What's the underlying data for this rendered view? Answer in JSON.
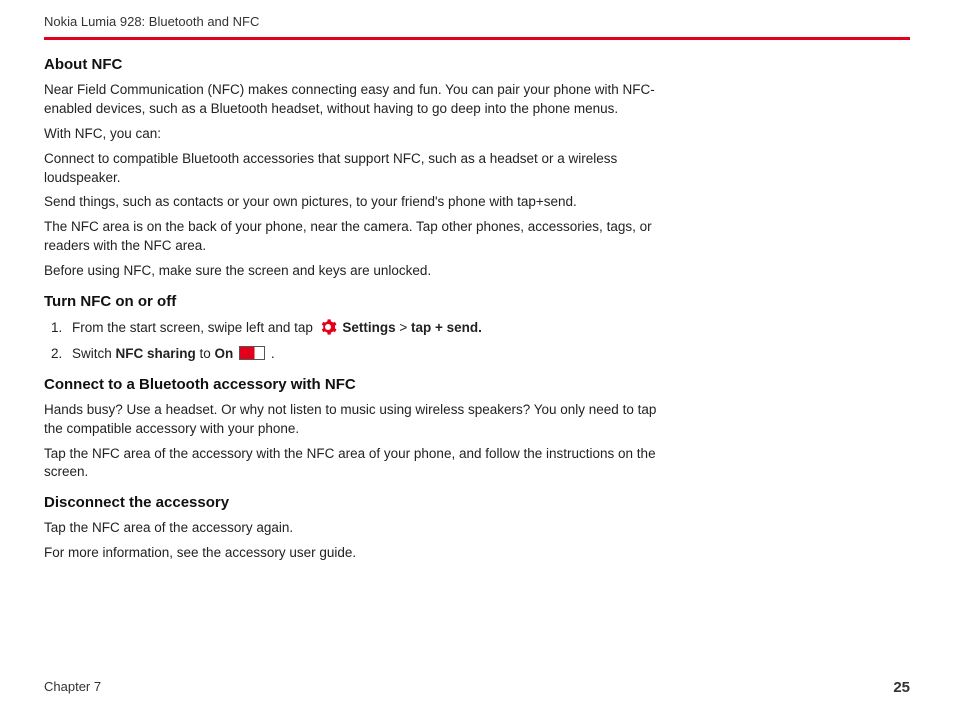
{
  "header": {
    "running_head": "Nokia Lumia 928: Bluetooth and NFC"
  },
  "sections": {
    "about_nfc": {
      "title": "About NFC",
      "p1": "Near Field Communication (NFC) makes connecting easy and fun. You can pair your phone with NFC-enabled devices, such as a Bluetooth headset, without having to go deep into the phone menus.",
      "p2": "With NFC, you can:",
      "p3": "Connect to compatible Bluetooth accessories that support NFC, such as a headset or a wireless loudspeaker.",
      "p4": "Send things, such as contacts or your own pictures, to your friend's phone with tap+send.",
      "p5": "The NFC area is on the back of your phone, near the camera. Tap other phones, accessories, tags, or readers with the NFC area.",
      "p6": "Before using NFC, make sure the screen and keys are unlocked."
    },
    "turn_nfc": {
      "title": "Turn NFC on or off",
      "step1_a": "From the start screen, swipe left and tap ",
      "step1_settings": "Settings",
      "step1_gt": " > ",
      "step1_tapsend": "tap + send.",
      "step2_a": "Switch ",
      "step2_nfc": "NFC sharing",
      "step2_b": " to ",
      "step2_on": "On",
      "step2_c": " ."
    },
    "connect_bt": {
      "title": "Connect to a Bluetooth accessory with NFC",
      "p1": "Hands busy? Use a headset. Or why not listen to music using wireless speakers? You only need to tap the compatible accessory with your phone.",
      "p2": "Tap the NFC area of the accessory with the NFC area of your phone, and follow the instructions on the screen."
    },
    "disconnect": {
      "title": "Disconnect the accessory",
      "p1": "Tap the NFC area of the accessory again.",
      "p2": "For more information, see the accessory user guide."
    }
  },
  "footer": {
    "chapter": "Chapter 7",
    "page": "25"
  }
}
